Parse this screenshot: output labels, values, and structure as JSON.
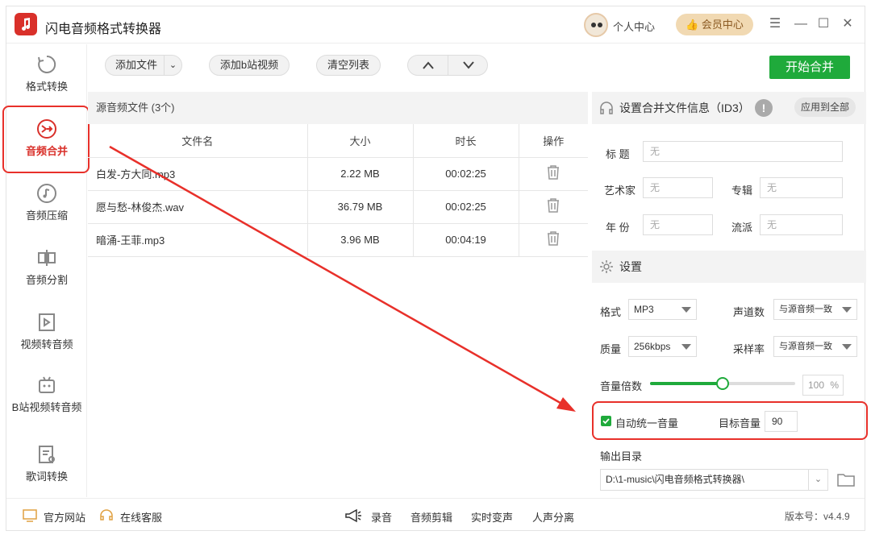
{
  "app": {
    "title": "闪电音频格式转换器",
    "personal_center": "个人中心",
    "vip_center": "会员中心"
  },
  "sidebar": {
    "items": [
      {
        "label": "格式转换",
        "icon": "refresh-icon"
      },
      {
        "label": "音频合并",
        "icon": "merge-icon",
        "active": true
      },
      {
        "label": "音频压缩",
        "icon": "music-note-icon"
      },
      {
        "label": "音频分割",
        "icon": "split-icon"
      },
      {
        "label": "视频转音频",
        "icon": "video-icon"
      },
      {
        "label": "B站视频转音频",
        "icon": "bilibili-icon"
      },
      {
        "label": "歌词转换",
        "icon": "lyrics-icon"
      }
    ]
  },
  "toolbar": {
    "add_file": "添加文件",
    "add_bilibili": "添加b站视频",
    "clear_list": "清空列表",
    "start_merge": "开始合并"
  },
  "file_list": {
    "header": "源音频文件 (3个)",
    "columns": [
      "文件名",
      "大小",
      "时长",
      "操作"
    ],
    "rows": [
      {
        "name": "白发-方大同.mp3",
        "size": "2.22 MB",
        "duration": "00:02:25"
      },
      {
        "name": "愿与愁-林俊杰.wav",
        "size": "36.79 MB",
        "duration": "00:02:25"
      },
      {
        "name": "暗涌-王菲.mp3",
        "size": "3.96 MB",
        "duration": "00:04:19"
      }
    ]
  },
  "info_panel": {
    "title": "设置合并文件信息（ID3）",
    "apply_all": "应用到全部",
    "title_label": "标 题",
    "title_placeholder": "无",
    "artist_label": "艺术家",
    "artist_placeholder": "无",
    "album_label": "专辑",
    "album_placeholder": "无",
    "year_label": "年 份",
    "year_placeholder": "无",
    "genre_label": "流派",
    "genre_placeholder": "无"
  },
  "settings": {
    "title": "设置",
    "format_label": "格式",
    "format_value": "MP3",
    "channels_label": "声道数",
    "channels_value": "与源音频一致",
    "quality_label": "质量",
    "quality_value": "256kbps",
    "samplerate_label": "采样率",
    "samplerate_value": "与源音频一致",
    "volume_label": "音量倍数",
    "volume_value": "100",
    "volume_unit": "%",
    "volume_level": 0.5,
    "auto_volume_label": "自动统一音量",
    "auto_volume_checked": true,
    "target_volume_label": "目标音量",
    "target_volume_value": "90",
    "output_label": "输出目录",
    "output_path": "D:\\1-music\\闪电音频格式转换器\\"
  },
  "footer": {
    "website": "官方网站",
    "service": "在线客服",
    "record": "录音",
    "edit": "音频剪辑",
    "realtime": "实时变声",
    "separate": "人声分离",
    "version": "版本号：v4.4.9"
  },
  "colors": {
    "accent": "#d9302a",
    "green": "#1faa3b",
    "annotation": "#e8302a"
  }
}
